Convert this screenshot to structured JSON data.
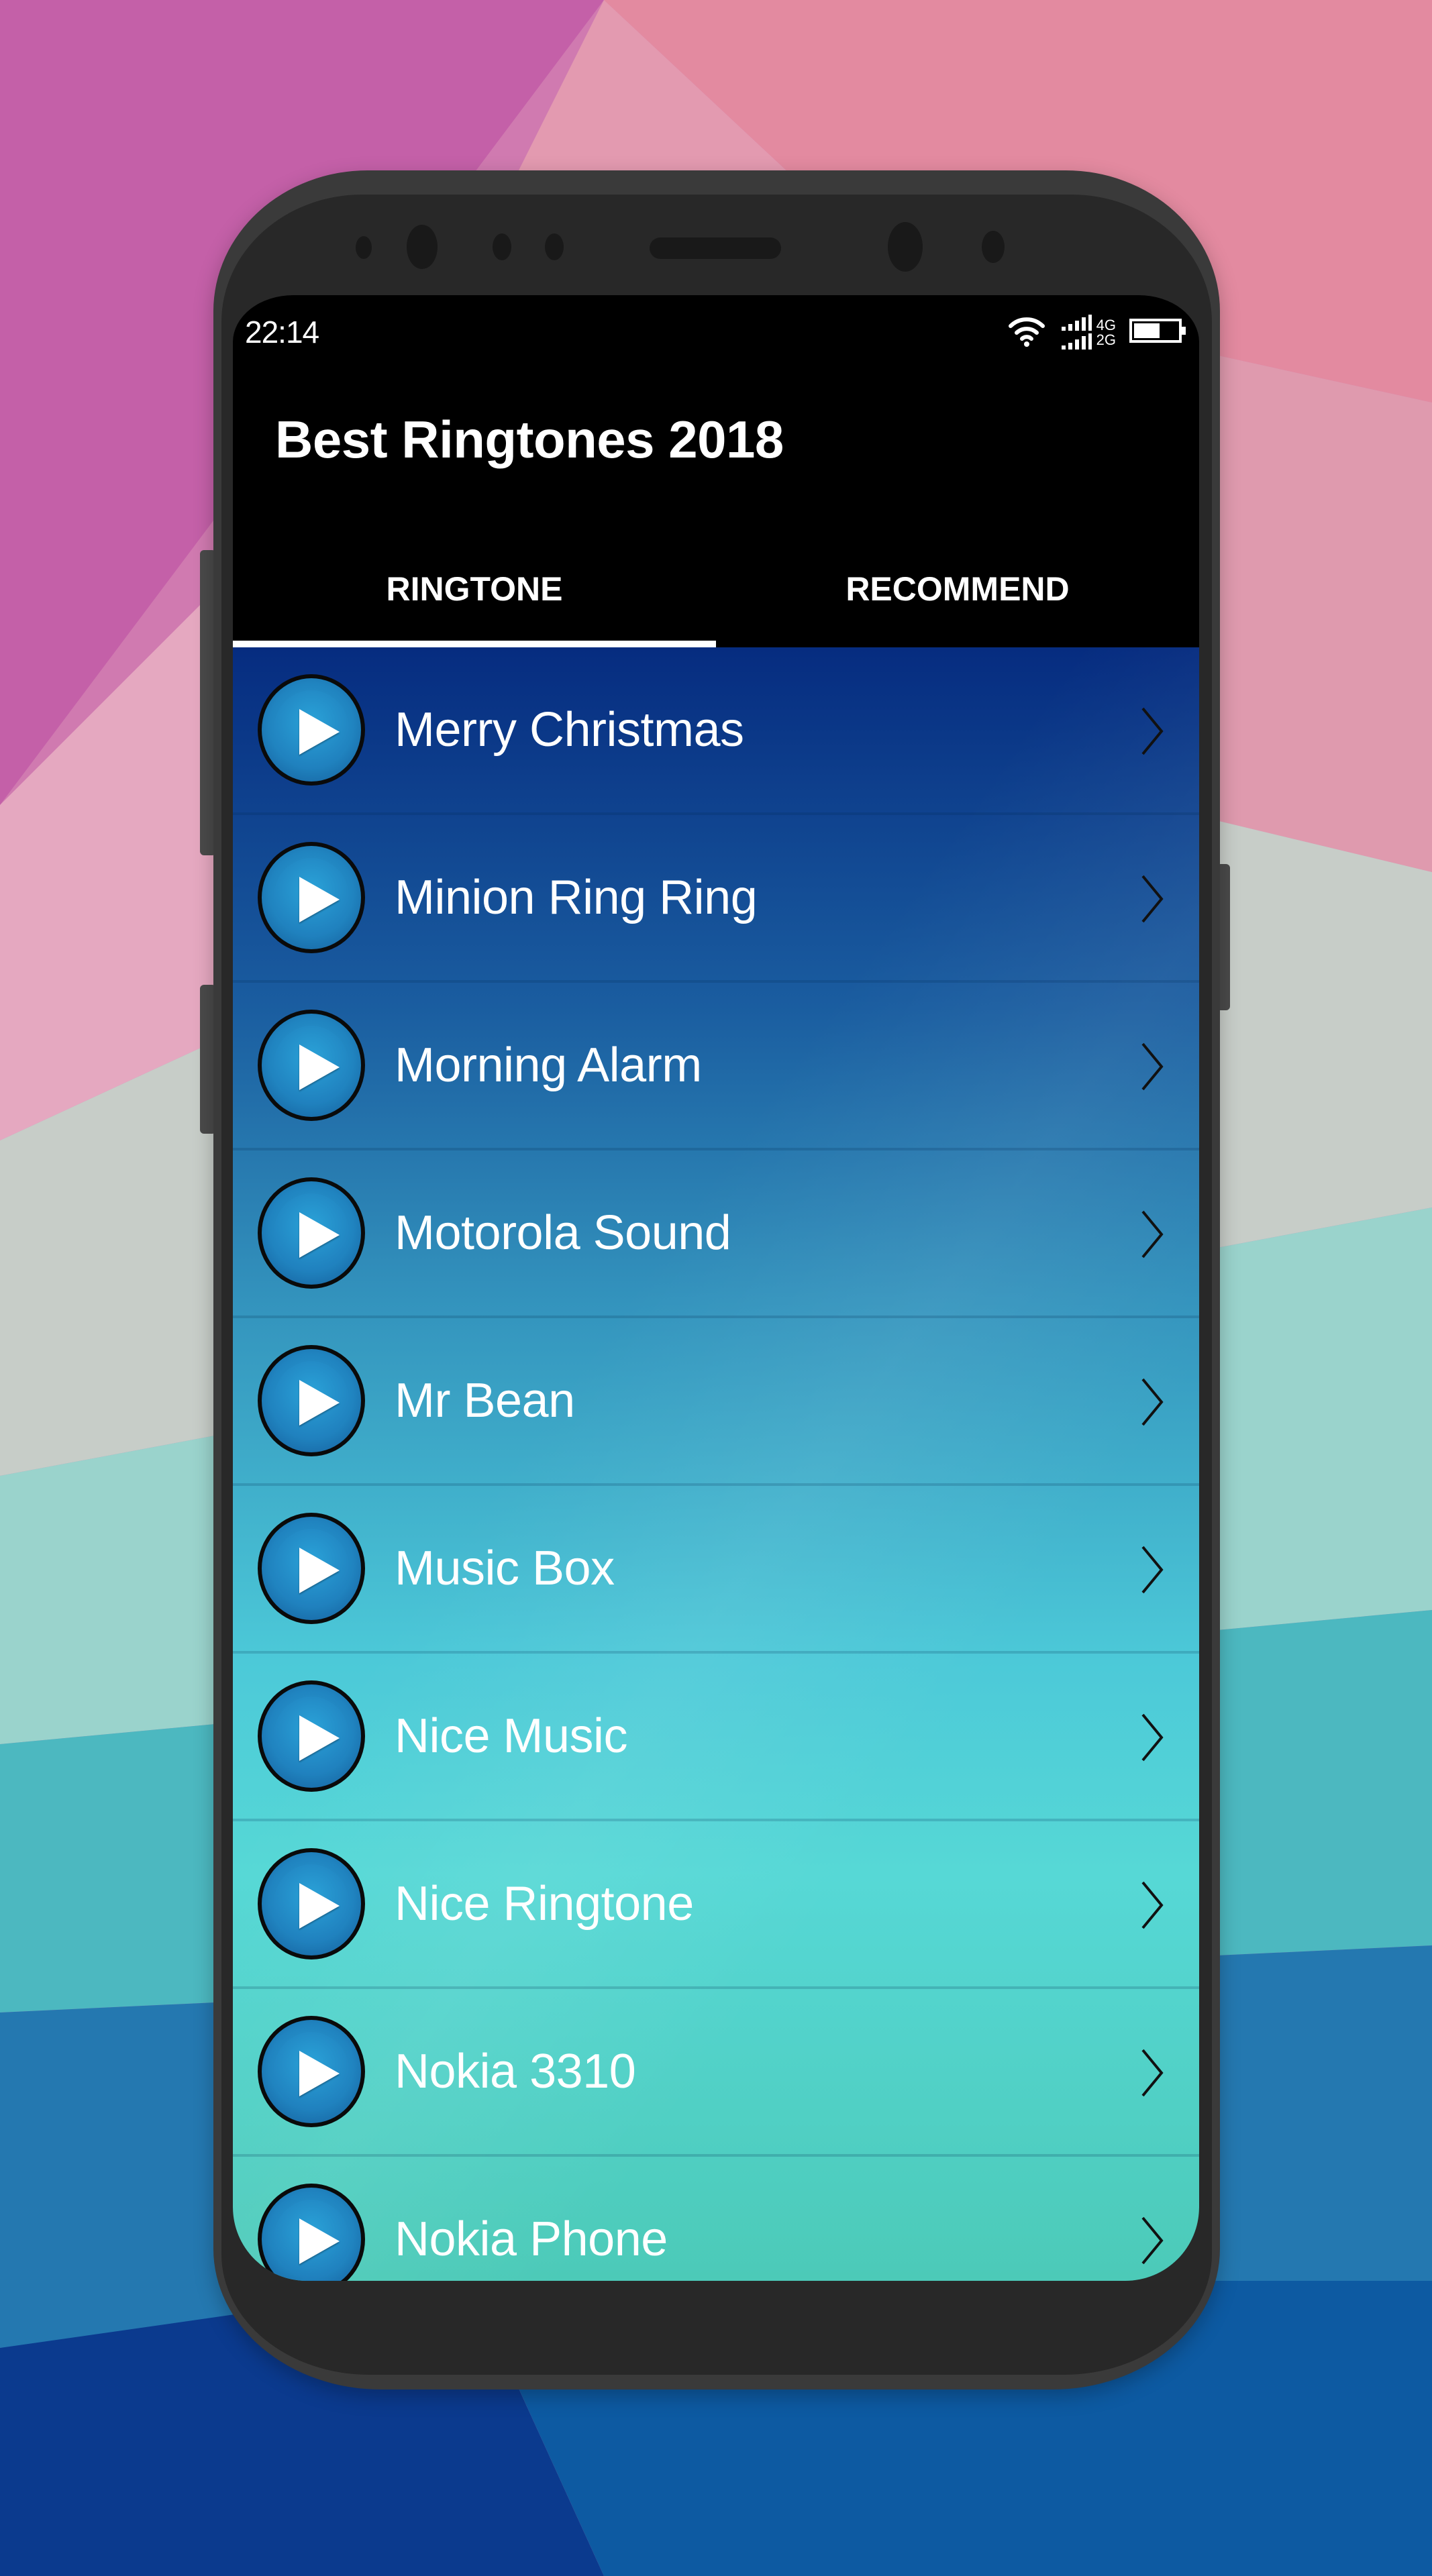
{
  "status_bar": {
    "time": "22:14",
    "network_top": "4G",
    "network_bottom": "2G",
    "icons": [
      "wifi-icon",
      "signal-icon",
      "battery-icon"
    ],
    "battery_level": 0.6
  },
  "app": {
    "title": "Best Ringtones 2018"
  },
  "tabs": [
    {
      "label": "RINGTONE",
      "active": true
    },
    {
      "label": "RECOMMEND",
      "active": false
    }
  ],
  "ringtones": [
    {
      "title": "Merry Christmas"
    },
    {
      "title": "Minion Ring Ring"
    },
    {
      "title": "Morning Alarm"
    },
    {
      "title": "Motorola Sound"
    },
    {
      "title": "Mr Bean"
    },
    {
      "title": "Music Box"
    },
    {
      "title": "Nice Music"
    },
    {
      "title": "Nice Ringtone"
    },
    {
      "title": "Nokia 3310"
    },
    {
      "title": "Nokia Phone"
    }
  ],
  "colors": {
    "app_bar": "#000000",
    "list_top": "#062c80",
    "list_bottom": "#4ccab8",
    "play_button": "#2084c0",
    "phone_frame": "#282828"
  }
}
